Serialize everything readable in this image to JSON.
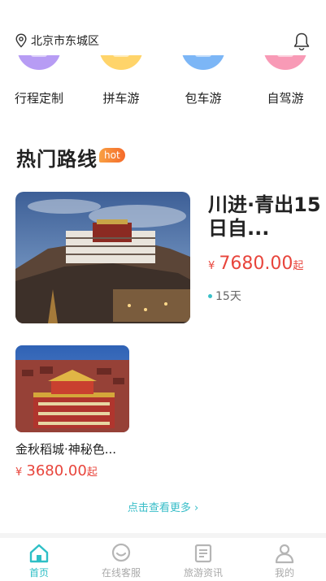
{
  "header": {
    "location": "北京市东城区"
  },
  "categories": [
    {
      "label": "行程定制",
      "color": "#b79cf4"
    },
    {
      "label": "拼车游",
      "color": "#ffd46a"
    },
    {
      "label": "包车游",
      "color": "#7cb6f6"
    },
    {
      "label": "自驾游",
      "color": "#f89ab6"
    }
  ],
  "section": {
    "title": "热门路线",
    "badge": "hot"
  },
  "routes": [
    {
      "title": "川进·青出15日自...",
      "price_symbol": "¥",
      "price": "7680.00",
      "price_unit": "起",
      "duration": "15天"
    },
    {
      "title": "金秋稻城·神秘色...",
      "price_symbol": "¥",
      "price": "3680.00",
      "price_unit": "起"
    }
  ],
  "more_link": "点击查看更多",
  "tabs": [
    {
      "label": "首页",
      "active": true
    },
    {
      "label": "在线客服",
      "active": false
    },
    {
      "label": "旅游资讯",
      "active": false
    },
    {
      "label": "我的",
      "active": false
    }
  ],
  "colors": {
    "accent": "#2ebfc6",
    "price": "#e8453c",
    "hot_badge": "#f6802f"
  }
}
